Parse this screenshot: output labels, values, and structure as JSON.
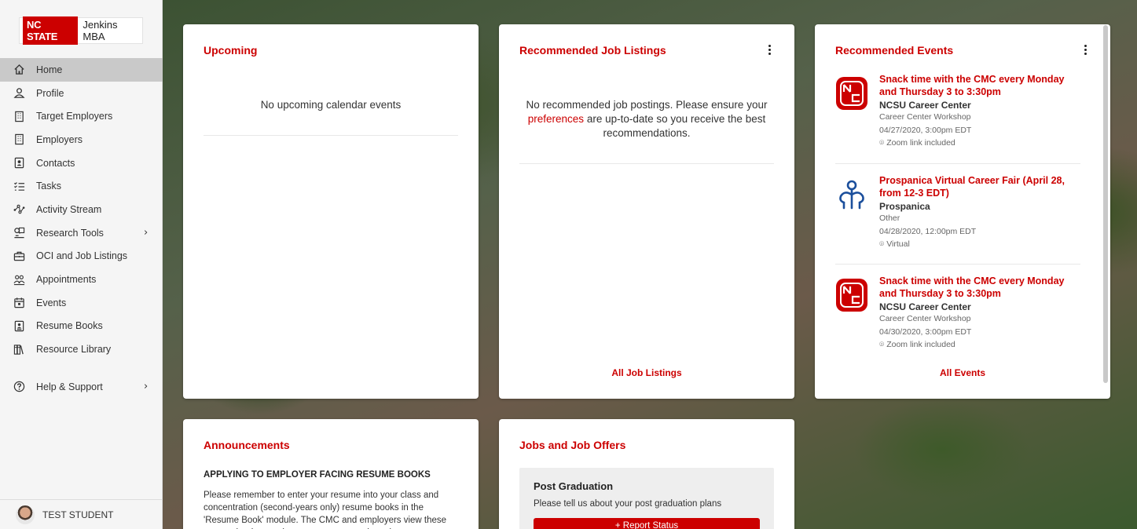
{
  "brand": {
    "badge": "NC STATE",
    "program": "Jenkins MBA"
  },
  "sidebar": {
    "items": [
      {
        "label": "Home",
        "icon": "home-icon"
      },
      {
        "label": "Profile",
        "icon": "person-icon"
      },
      {
        "label": "Target Employers",
        "icon": "building-icon"
      },
      {
        "label": "Employers",
        "icon": "building-icon"
      },
      {
        "label": "Contacts",
        "icon": "contact-card-icon"
      },
      {
        "label": "Tasks",
        "icon": "checklist-icon"
      },
      {
        "label": "Activity Stream",
        "icon": "network-icon"
      },
      {
        "label": "Research Tools",
        "icon": "research-icon"
      },
      {
        "label": "OCI and Job Listings",
        "icon": "briefcase-icon"
      },
      {
        "label": "Appointments",
        "icon": "people-icon"
      },
      {
        "label": "Events",
        "icon": "calendar-icon"
      },
      {
        "label": "Resume Books",
        "icon": "resume-book-icon"
      },
      {
        "label": "Resource Library",
        "icon": "library-icon"
      }
    ],
    "help": "Help & Support",
    "user": "TEST STUDENT",
    "chevron": "›"
  },
  "upcoming": {
    "title": "Upcoming",
    "empty": "No upcoming calendar events"
  },
  "jobs": {
    "title": "Recommended Job Listings",
    "empty_pre": "No recommended job postings. Please ensure your",
    "empty_link": "preferences",
    "empty_post": "are up-to-date so you receive the best recommendations.",
    "footer": "All Job Listings"
  },
  "events": {
    "title": "Recommended Events",
    "footer": "All Events",
    "items": [
      {
        "title": "Snack time with the CMC every Monday and Thursday 3 to 3:30pm",
        "org": "NCSU Career Center",
        "type": "Career Center Workshop",
        "when": "04/27/2020, 3:00pm EDT",
        "where": "Zoom link included",
        "logo": "nc-state-logo"
      },
      {
        "title": "Prospanica Virtual Career Fair (April 28, from 12-3 EDT)",
        "org": "Prospanica",
        "type": "Other",
        "when": "04/28/2020, 12:00pm EDT",
        "where": "Virtual",
        "logo": "prospanica-logo"
      },
      {
        "title": "Snack time with the CMC every Monday and Thursday 3 to 3:30pm",
        "org": "NCSU Career Center",
        "type": "Career Center Workshop",
        "when": "04/30/2020, 3:00pm EDT",
        "where": "Zoom link included",
        "logo": "nc-state-logo"
      }
    ]
  },
  "announcements": {
    "title": "Announcements",
    "headline": "APPLYING TO EMPLOYER FACING RESUME BOOKS",
    "body": "Please remember to enter your resume into your class and concentration (second-years only) resume books in the 'Resume Book' module. The CMC and employers view these resume books as a key resource to recruit students on."
  },
  "job_offers": {
    "title": "Jobs and Job Offers",
    "box_title": "Post Graduation",
    "box_sub": "Please tell us about your post graduation plans",
    "button": "+ Report Status"
  },
  "colors": {
    "accent": "#cc0000",
    "sidebar_bg": "#f5f5f5",
    "active_bg": "#c9c9c9"
  }
}
